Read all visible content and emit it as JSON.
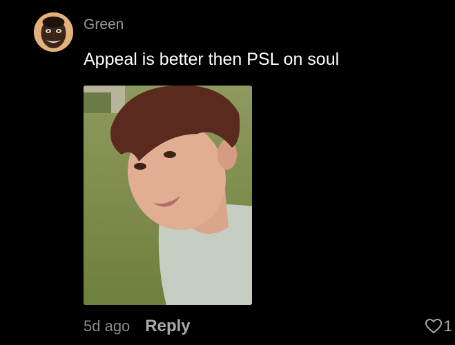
{
  "comment": {
    "username": "Green",
    "text": "Appeal is better then PSL on soul",
    "timestamp": "5d ago",
    "reply_label": "Reply",
    "like_count": "1",
    "icons": {
      "avatar": "avatar",
      "like": "heart-icon"
    },
    "colors": {
      "background": "#000000",
      "username": "#9a9a9a",
      "text": "#ffffff",
      "meta": "#8a8a8a"
    }
  }
}
